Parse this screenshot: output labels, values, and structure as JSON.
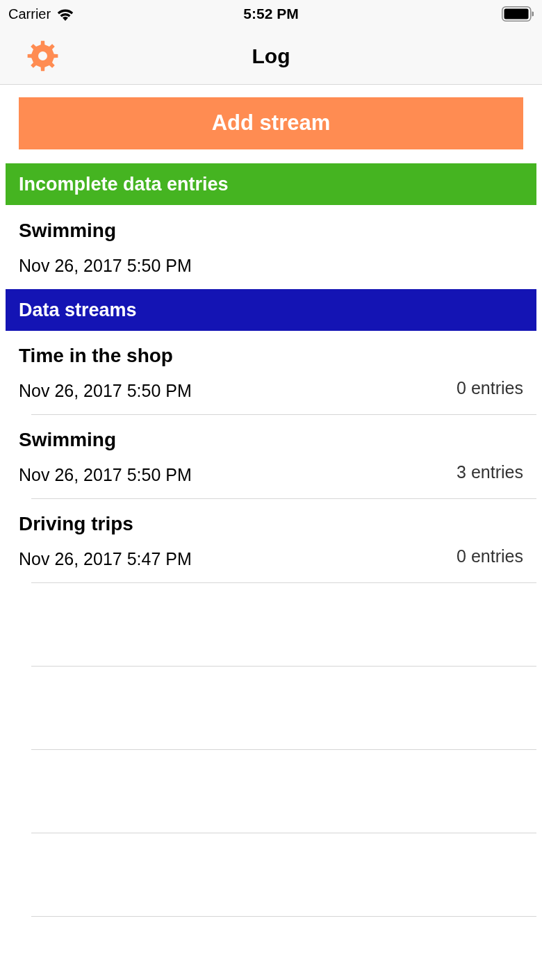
{
  "status_bar": {
    "carrier": "Carrier",
    "time": "5:52 PM"
  },
  "nav_bar": {
    "title": "Log"
  },
  "add_button": {
    "label": "Add stream"
  },
  "sections": [
    {
      "kind": "incomplete",
      "title": "Incomplete data entries",
      "color": "#45b421",
      "rows": [
        {
          "title": "Swimming",
          "date": "Nov 26, 2017 5:50 PM"
        }
      ]
    },
    {
      "kind": "streams",
      "title": "Data streams",
      "color": "#1414b4",
      "rows": [
        {
          "title": "Time in the shop",
          "date": "Nov 26, 2017 5:50 PM",
          "count": "0 entries"
        },
        {
          "title": "Swimming",
          "date": "Nov 26, 2017 5:50 PM",
          "count": "3 entries"
        },
        {
          "title": "Driving trips",
          "date": "Nov 26, 2017 5:47 PM",
          "count": "0 entries"
        }
      ]
    }
  ]
}
